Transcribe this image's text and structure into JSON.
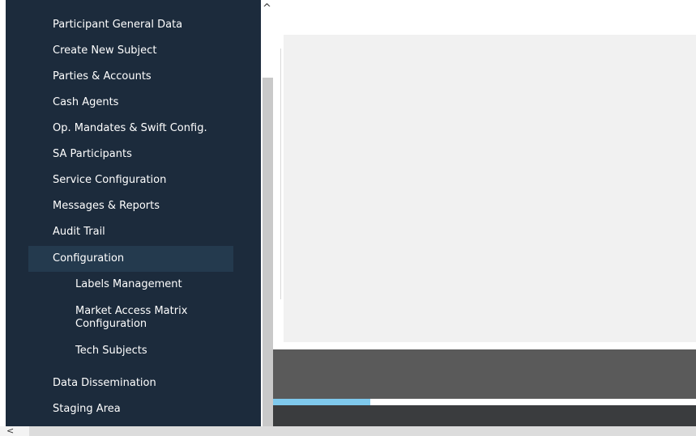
{
  "sidebar": {
    "items": [
      {
        "label": "Participant General Data"
      },
      {
        "label": "Create New Subject"
      },
      {
        "label": "Parties & Accounts"
      },
      {
        "label": "Cash Agents"
      },
      {
        "label": "Op. Mandates & Swift Config."
      },
      {
        "label": "SA Participants"
      },
      {
        "label": "Service Configuration"
      },
      {
        "label": "Messages & Reports"
      },
      {
        "label": "Audit Trail"
      },
      {
        "label": "Configuration"
      },
      {
        "label": "Data Dissemination"
      },
      {
        "label": "Staging Area"
      }
    ],
    "subitems": [
      {
        "label": "Labels Management"
      },
      {
        "label": "Market Access Matrix Configuration"
      },
      {
        "label": "Tech Subjects"
      }
    ],
    "selected": "Configuration"
  },
  "scrollbars": {
    "up_arrow": "^",
    "left_arrow": "<"
  },
  "progress": {
    "fraction": 0.23
  },
  "colors": {
    "sidebar_bg": "#1c2b3c",
    "selected_bg": "#243a4e",
    "progress": "#7fc9ec",
    "content_bg": "#f1f1f1"
  }
}
